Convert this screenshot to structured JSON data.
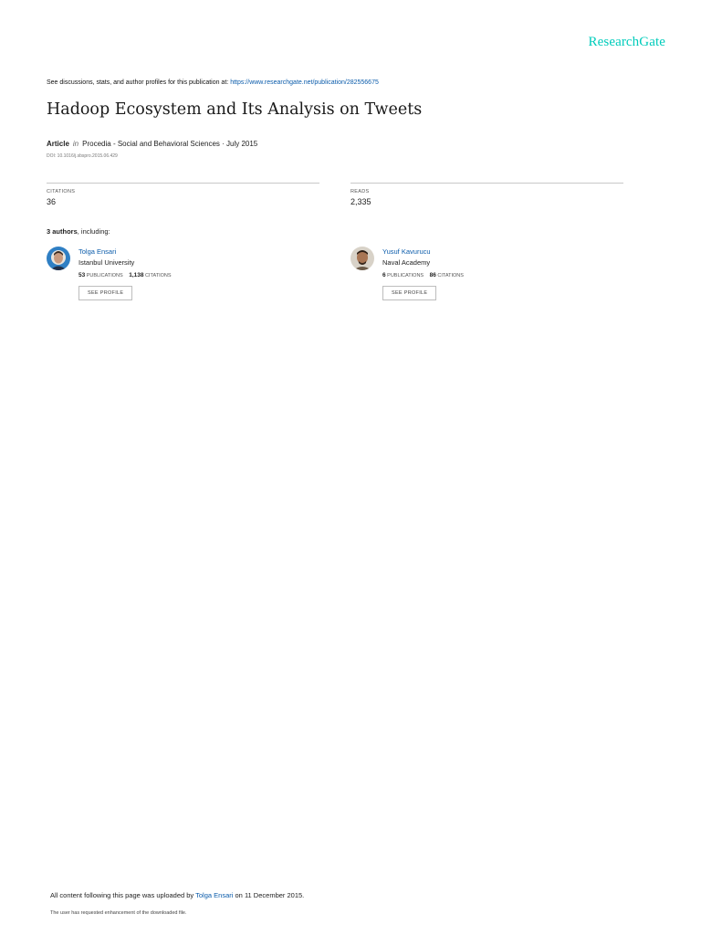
{
  "brand": {
    "logo_text": "ResearchGate",
    "accent_color": "#00ccbb",
    "link_color": "#0b5cab"
  },
  "intro": {
    "prefix": "See discussions, stats, and author profiles for this publication at:",
    "url": "https://www.researchgate.net/publication/282556675"
  },
  "publication": {
    "title": "Hadoop Ecosystem and Its Analysis on Tweets",
    "type": "Article",
    "in_word": "in",
    "venue": "Procedia - Social and Behavioral Sciences · July 2015",
    "doi": "DOI: 10.1016/j.sbspro.2015.06.429"
  },
  "stats": {
    "citations_label": "CITATIONS",
    "citations_value": "36",
    "reads_label": "READS",
    "reads_value": "2,335"
  },
  "authors_heading": {
    "count": "3 authors",
    "rest": ", including:"
  },
  "authors": [
    {
      "name": "Tolga Ensari",
      "institution": "Istanbul University",
      "publications": "53",
      "publications_label": "PUBLICATIONS",
      "citations": "1,138",
      "citations_label": "CITATIONS",
      "button": "SEE PROFILE",
      "avatar_icon": "person-photo-icon"
    },
    {
      "name": "Yusuf Kavurucu",
      "institution": "Naval Academy",
      "publications": "6",
      "publications_label": "PUBLICATIONS",
      "citations": "86",
      "citations_label": "CITATIONS",
      "button": "SEE PROFILE",
      "avatar_icon": "person-photo-icon"
    }
  ],
  "footer": {
    "uploaded_prefix": "All content following this page was uploaded by",
    "uploader": "Tolga Ensari",
    "uploaded_suffix": "on 11 December 2015.",
    "enhancement_note": "The user has requested enhancement of the downloaded file."
  }
}
